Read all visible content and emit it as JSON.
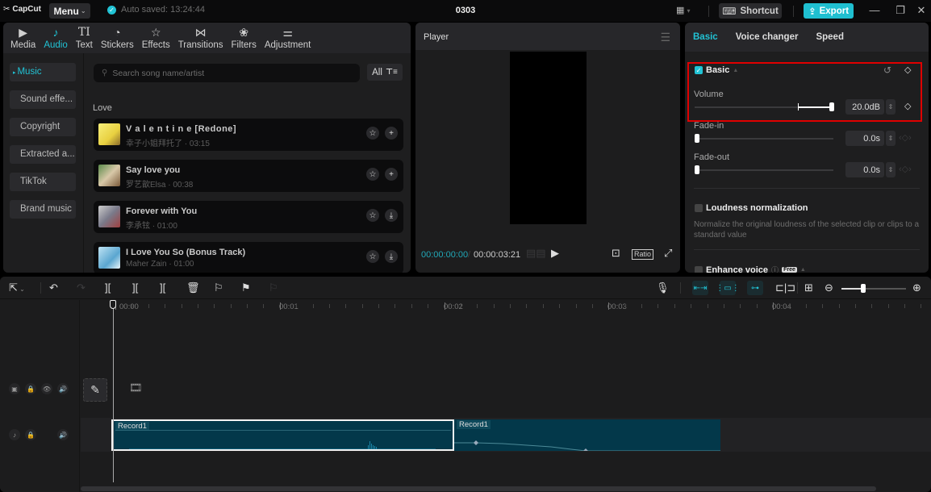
{
  "titlebar": {
    "app_name": "CapCut",
    "menu_label": "Menu",
    "autosave_text": "Auto saved: 13:24:44",
    "project_title": "0303",
    "shortcut_label": "Shortcut",
    "export_label": "Export",
    "accent_color": "#21c3d5"
  },
  "media_tabs": [
    {
      "label": "Media",
      "icon": "media-icon",
      "glyph": "▶"
    },
    {
      "label": "Audio",
      "icon": "audio-note-icon",
      "glyph": "♪",
      "active": true
    },
    {
      "label": "Text",
      "icon": "text-icon",
      "glyph": "TI"
    },
    {
      "label": "Stickers",
      "icon": "sticker-icon",
      "glyph": "◔"
    },
    {
      "label": "Effects",
      "icon": "effects-star-icon",
      "glyph": "☆"
    },
    {
      "label": "Transitions",
      "icon": "transitions-bowtie-icon",
      "glyph": "⋈"
    },
    {
      "label": "Filters",
      "icon": "filters-circles-icon",
      "glyph": "❀"
    },
    {
      "label": "Adjustment",
      "icon": "adjustment-sliders-icon",
      "glyph": "⚌"
    }
  ],
  "audio_categories": [
    {
      "label": "Music",
      "active": true
    },
    {
      "label": "Sound effe..."
    },
    {
      "label": "Copyright"
    },
    {
      "label": "Extracted a..."
    },
    {
      "label": "TikTok"
    },
    {
      "label": "Brand music"
    }
  ],
  "search": {
    "placeholder": "Search song name/artist",
    "value": ""
  },
  "filter": {
    "label": "All"
  },
  "section_label": "Love",
  "songs": [
    {
      "title": "V a l e n t i n e [Redone]",
      "artist": "幸子小姐拜托了",
      "duration": "03:15",
      "action": "add"
    },
    {
      "title": "Say love you",
      "artist": "罗艺歆Elsa",
      "duration": "00:38",
      "action": "add"
    },
    {
      "title": "Forever with You",
      "artist": "李承铉",
      "duration": "01:00",
      "action": "download"
    },
    {
      "title": "I Love You So (Bonus Track)",
      "artist": "Maher Zain",
      "duration": "01:00",
      "action": "download"
    }
  ],
  "player": {
    "title": "Player",
    "current_time": "00:00:00:00",
    "total_time": "00:00:03:21",
    "ratio_label": "Ratio"
  },
  "inspector": {
    "tabs": [
      {
        "label": "Basic",
        "active": true
      },
      {
        "label": "Voice changer"
      },
      {
        "label": "Speed"
      }
    ],
    "basic": {
      "title": "Basic",
      "enabled": true,
      "volume": {
        "label": "Volume",
        "value": "20.0dB",
        "slider_fraction": 1.0
      },
      "fade_in": {
        "label": "Fade-in",
        "value": "0.0s",
        "slider_fraction": 0.0
      },
      "fade_out": {
        "label": "Fade-out",
        "value": "0.0s",
        "slider_fraction": 0.0
      }
    },
    "loudness": {
      "title": "Loudness normalization",
      "enabled": false,
      "description": "Normalize the original loudness of the selected clip or clips to a standard value"
    },
    "enhance": {
      "title": "Enhance voice",
      "badge": "Free",
      "enabled": false
    }
  },
  "timeline": {
    "ruler_labels": [
      "00:00",
      "00:01",
      "00:02",
      "00:03",
      "00:04"
    ],
    "zoom_fraction": 0.33,
    "clips": [
      {
        "name": "Record1",
        "selected": true
      },
      {
        "name": "Record1",
        "selected": false
      }
    ]
  }
}
